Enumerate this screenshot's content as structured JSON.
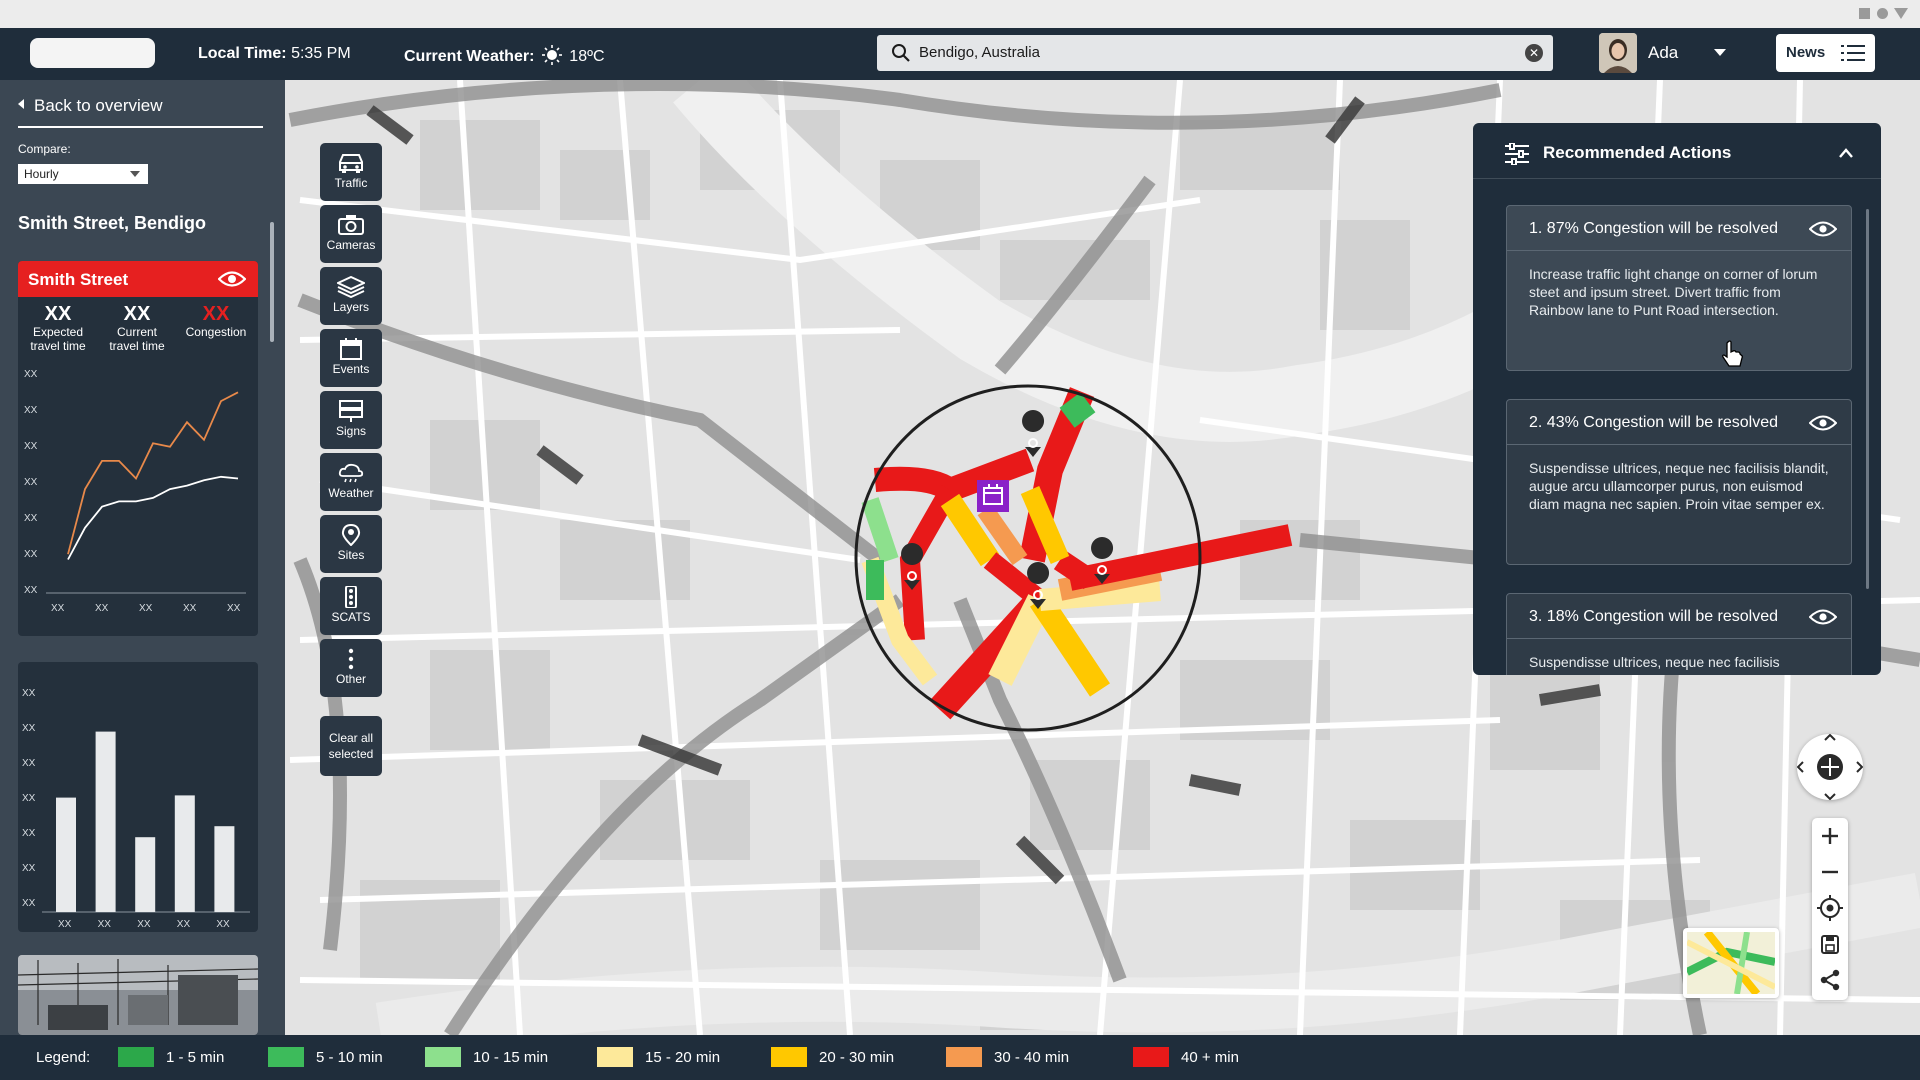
{
  "header": {
    "local_time_label": "Local Time:",
    "local_time": "5:35 PM",
    "weather_label": "Current Weather:",
    "weather_value": "18ºC",
    "search_value": "Bendigo, Australia",
    "user_name": "Ada",
    "news_label": "News"
  },
  "left_panel": {
    "back_label": "Back to overview",
    "compare_label": "Compare:",
    "compare_value": "Hourly",
    "street_title": "Smith Street, Bendigo",
    "card_title": "Smith Street",
    "stats": [
      {
        "value": "XX",
        "label_line1": "Expected",
        "label_line2": "travel time"
      },
      {
        "value": "XX",
        "label_line1": "Current",
        "label_line2": "travel time"
      },
      {
        "value": "XX",
        "label_line1": "Congestion",
        "label_line2": ""
      }
    ],
    "line_chart": {
      "y_ticks": [
        "XX",
        "XX",
        "XX",
        "XX",
        "XX",
        "XX",
        "XX"
      ],
      "x_ticks": [
        "XX",
        "XX",
        "XX",
        "XX",
        "XX"
      ]
    },
    "bar_chart": {
      "y_ticks": [
        "XX",
        "XX",
        "XX",
        "XX",
        "XX",
        "XX",
        "XX"
      ],
      "x_ticks": [
        "XX",
        "XX",
        "XX",
        "XX",
        "XX"
      ]
    }
  },
  "chart_data": [
    {
      "type": "line",
      "series": [
        {
          "color": "#e8894a",
          "values": [
            0.05,
            0.42,
            0.58,
            0.58,
            0.48,
            0.68,
            0.66,
            0.8,
            0.7,
            0.92,
            0.97
          ]
        },
        {
          "color": "#ffffff",
          "values": [
            0.02,
            0.2,
            0.32,
            0.35,
            0.35,
            0.37,
            0.42,
            0.44,
            0.47,
            0.49,
            0.48
          ]
        }
      ]
    },
    {
      "type": "bar",
      "values": [
        0.52,
        0.82,
        0.34,
        0.53,
        0.39
      ]
    }
  ],
  "tools": [
    {
      "label": "Traffic",
      "icon": "car-icon"
    },
    {
      "label": "Cameras",
      "icon": "camera-icon"
    },
    {
      "label": "Layers",
      "icon": "layers-icon"
    },
    {
      "label": "Events",
      "icon": "calendar-icon"
    },
    {
      "label": "Signs",
      "icon": "signs-icon"
    },
    {
      "label": "Weather",
      "icon": "cloud-icon"
    },
    {
      "label": "Sites",
      "icon": "pin-icon"
    },
    {
      "label": "SCATS",
      "icon": "traffic-light-icon"
    },
    {
      "label": "Other",
      "icon": "more-icon"
    }
  ],
  "clear_all_line1": "Clear all",
  "clear_all_line2": "selected",
  "recommended": {
    "title": "Recommended Actions",
    "actions": [
      {
        "title": "1. 87% Congestion will be resolved",
        "body": "Increase traffic light change on corner of lorum steet and ipsum street. Divert traffic from Rainbow lane to Punt Road intersection."
      },
      {
        "title": "2. 43% Congestion will be resolved",
        "body": "Suspendisse ultrices, neque nec facilisis blandit, augue arcu ullamcorper purus, non euismod diam magna nec sapien. Proin vitae semper ex."
      },
      {
        "title": "3. 18% Congestion will be resolved",
        "body": "Suspendisse ultrices, neque nec facilisis"
      }
    ]
  },
  "legend": {
    "title": "Legend:",
    "items": [
      {
        "label": "1 - 5 min",
        "color": "#2ca84a"
      },
      {
        "label": "5 - 10 min",
        "color": "#3dbb5b"
      },
      {
        "label": "10 - 15 min",
        "color": "#8de08d"
      },
      {
        "label": "15 - 20 min",
        "color": "#fde99a"
      },
      {
        "label": "20 - 30 min",
        "color": "#ffc800"
      },
      {
        "label": "30 - 40 min",
        "color": "#f59a50"
      },
      {
        "label": "40 + min",
        "color": "#e81919"
      }
    ]
  }
}
